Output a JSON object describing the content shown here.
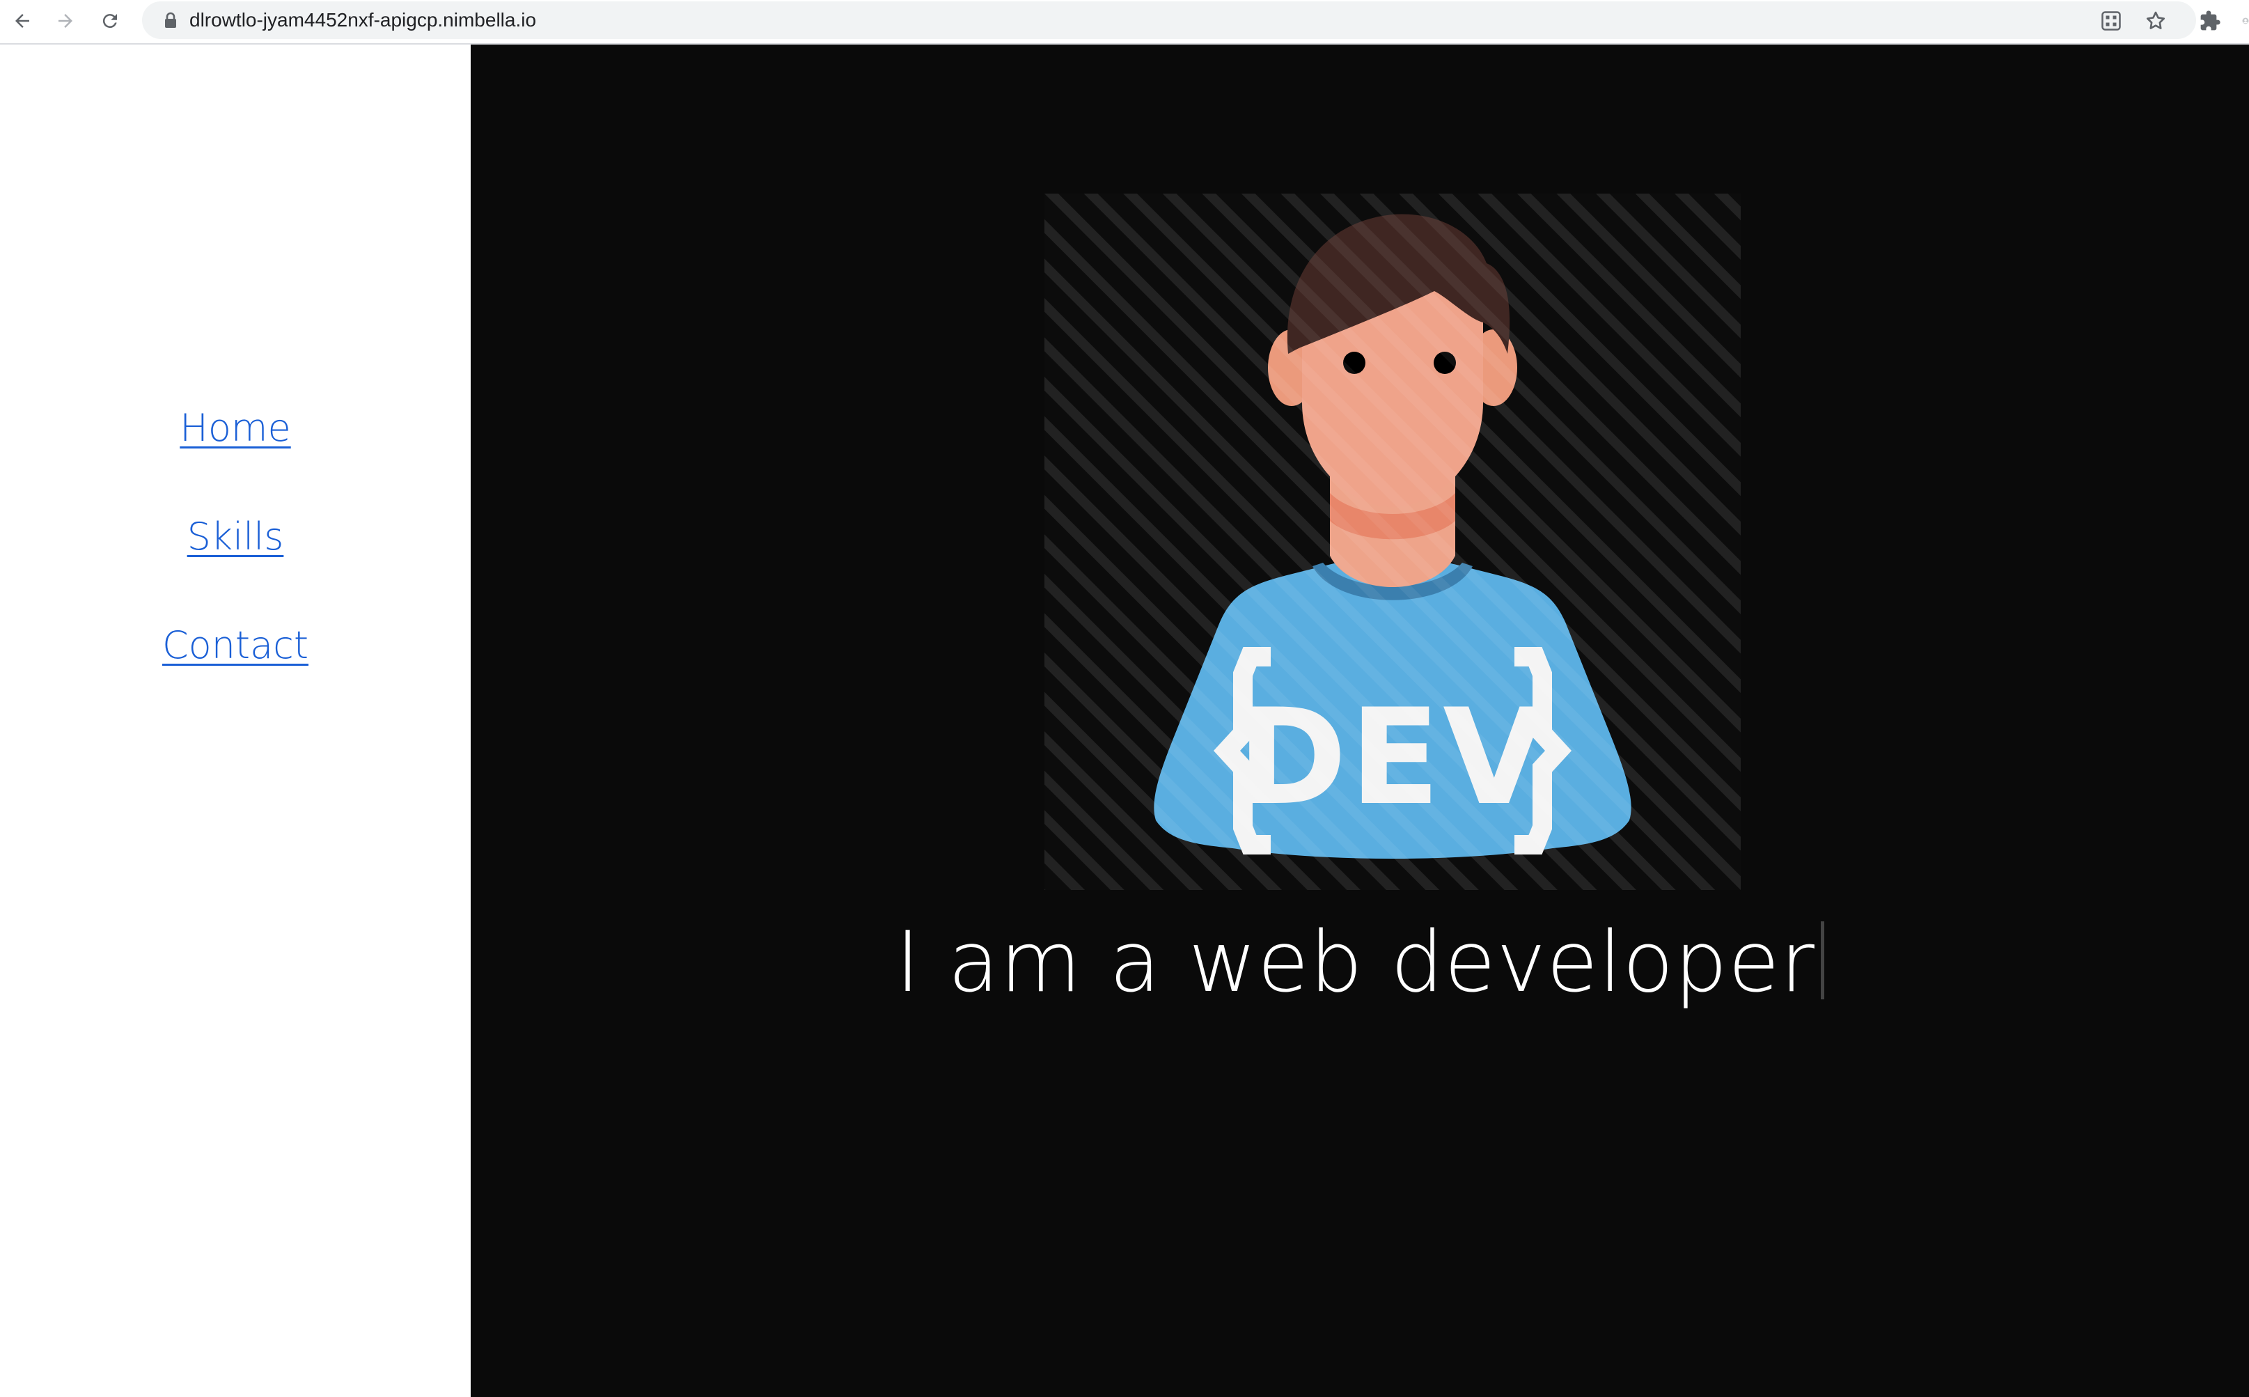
{
  "browser": {
    "url": "dlrowtlo-jyam4452nxf-apigcp.nimbella.io"
  },
  "sidebar": {
    "items": [
      {
        "label": "Home"
      },
      {
        "label": "Skills"
      },
      {
        "label": "Contact"
      }
    ],
    "link_color": "#1a5fd6"
  },
  "hero": {
    "tagline": "I am a web developer",
    "badge_text": "{DEV}",
    "background_color": "#0a0a0a",
    "shirt_color": "#5aaee0"
  }
}
